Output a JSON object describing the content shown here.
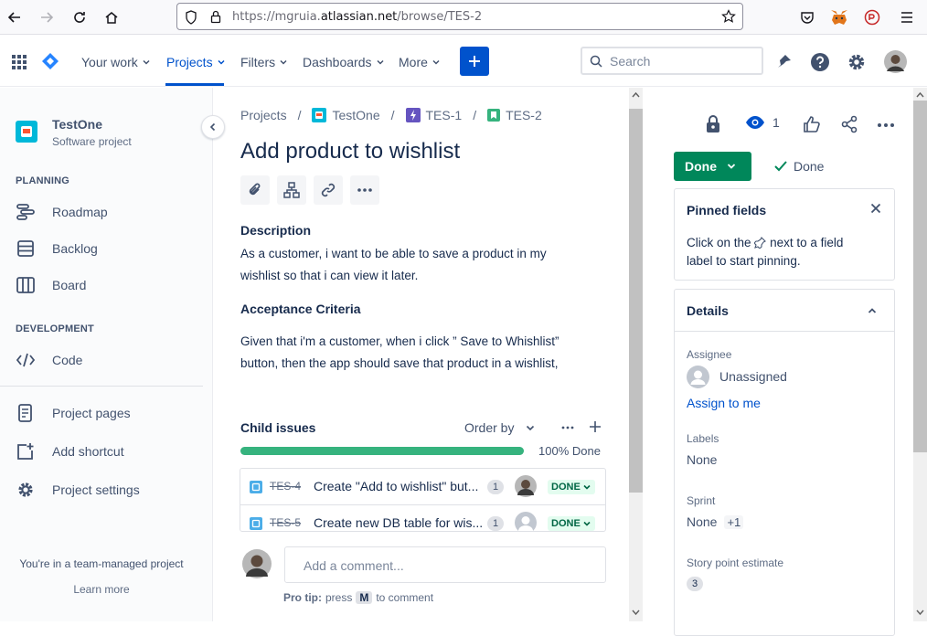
{
  "browser": {
    "url_prefix": "https://mgruia.",
    "url_host": "atlassian.net",
    "url_path": "/browse/TES-2"
  },
  "topnav": {
    "items": [
      {
        "label": "Your work"
      },
      {
        "label": "Projects"
      },
      {
        "label": "Filters"
      },
      {
        "label": "Dashboards"
      },
      {
        "label": "More"
      }
    ],
    "search_placeholder": "Search"
  },
  "sidebar": {
    "project_name": "TestOne",
    "project_type": "Software project",
    "planning_heading": "PLANNING",
    "planning_items": [
      {
        "label": "Roadmap"
      },
      {
        "label": "Backlog"
      },
      {
        "label": "Board"
      }
    ],
    "development_heading": "DEVELOPMENT",
    "development_items": [
      {
        "label": "Code"
      }
    ],
    "other_items": [
      {
        "label": "Project pages"
      },
      {
        "label": "Add shortcut"
      },
      {
        "label": "Project settings"
      }
    ],
    "footer_text": "You're in a team-managed project",
    "learn_more": "Learn more"
  },
  "breadcrumb": {
    "projects": "Projects",
    "project": "TestOne",
    "epic": "TES-1",
    "issue": "TES-2"
  },
  "issue": {
    "title": "Add product to wishlist",
    "description_heading": "Description",
    "description_line1": "As a customer, i want to be able to save a product in my",
    "description_line2": "wishlist so that i can view it later.",
    "ac_heading": "Acceptance Criteria",
    "ac_line1": "Given that i'm a customer, when i click ” Save to Whishlist”",
    "ac_line2": "button, then the app should save that product in a wishlist,"
  },
  "child_issues": {
    "heading": "Child issues",
    "order_by": "Order by",
    "progress_fraction": 1.0,
    "progress_label": "100% Done",
    "rows": [
      {
        "key": "TES-4",
        "summary": "Create \"Add to wishlist\" but...",
        "count": "1",
        "status": "DONE"
      },
      {
        "key": "TES-5",
        "summary": "Create new DB table for wis...",
        "count": "1",
        "status": "DONE"
      }
    ]
  },
  "comment": {
    "placeholder": "Add a comment...",
    "protip_bold": "Pro tip:",
    "protip_text1": "press",
    "protip_key": "M",
    "protip_text2": "to comment"
  },
  "right_panel": {
    "watch_count": "1",
    "status_button": "Done",
    "resolution": "Done",
    "pinned_title": "Pinned fields",
    "pinned_text1": "Click on the",
    "pinned_text2": "next to a field",
    "pinned_text3": "label to start pinning.",
    "details_title": "Details",
    "assignee_label": "Assignee",
    "assignee_value": "Unassigned",
    "assign_to_me": "Assign to me",
    "labels_label": "Labels",
    "labels_value": "None",
    "sprint_label": "Sprint",
    "sprint_value": "None",
    "sprint_extra": "+1",
    "story_points_label": "Story point estimate",
    "story_points_value": "3"
  },
  "colors": {
    "brand_blue": "#0052cc",
    "done_green": "#00875a",
    "progress_green": "#36b37e"
  }
}
